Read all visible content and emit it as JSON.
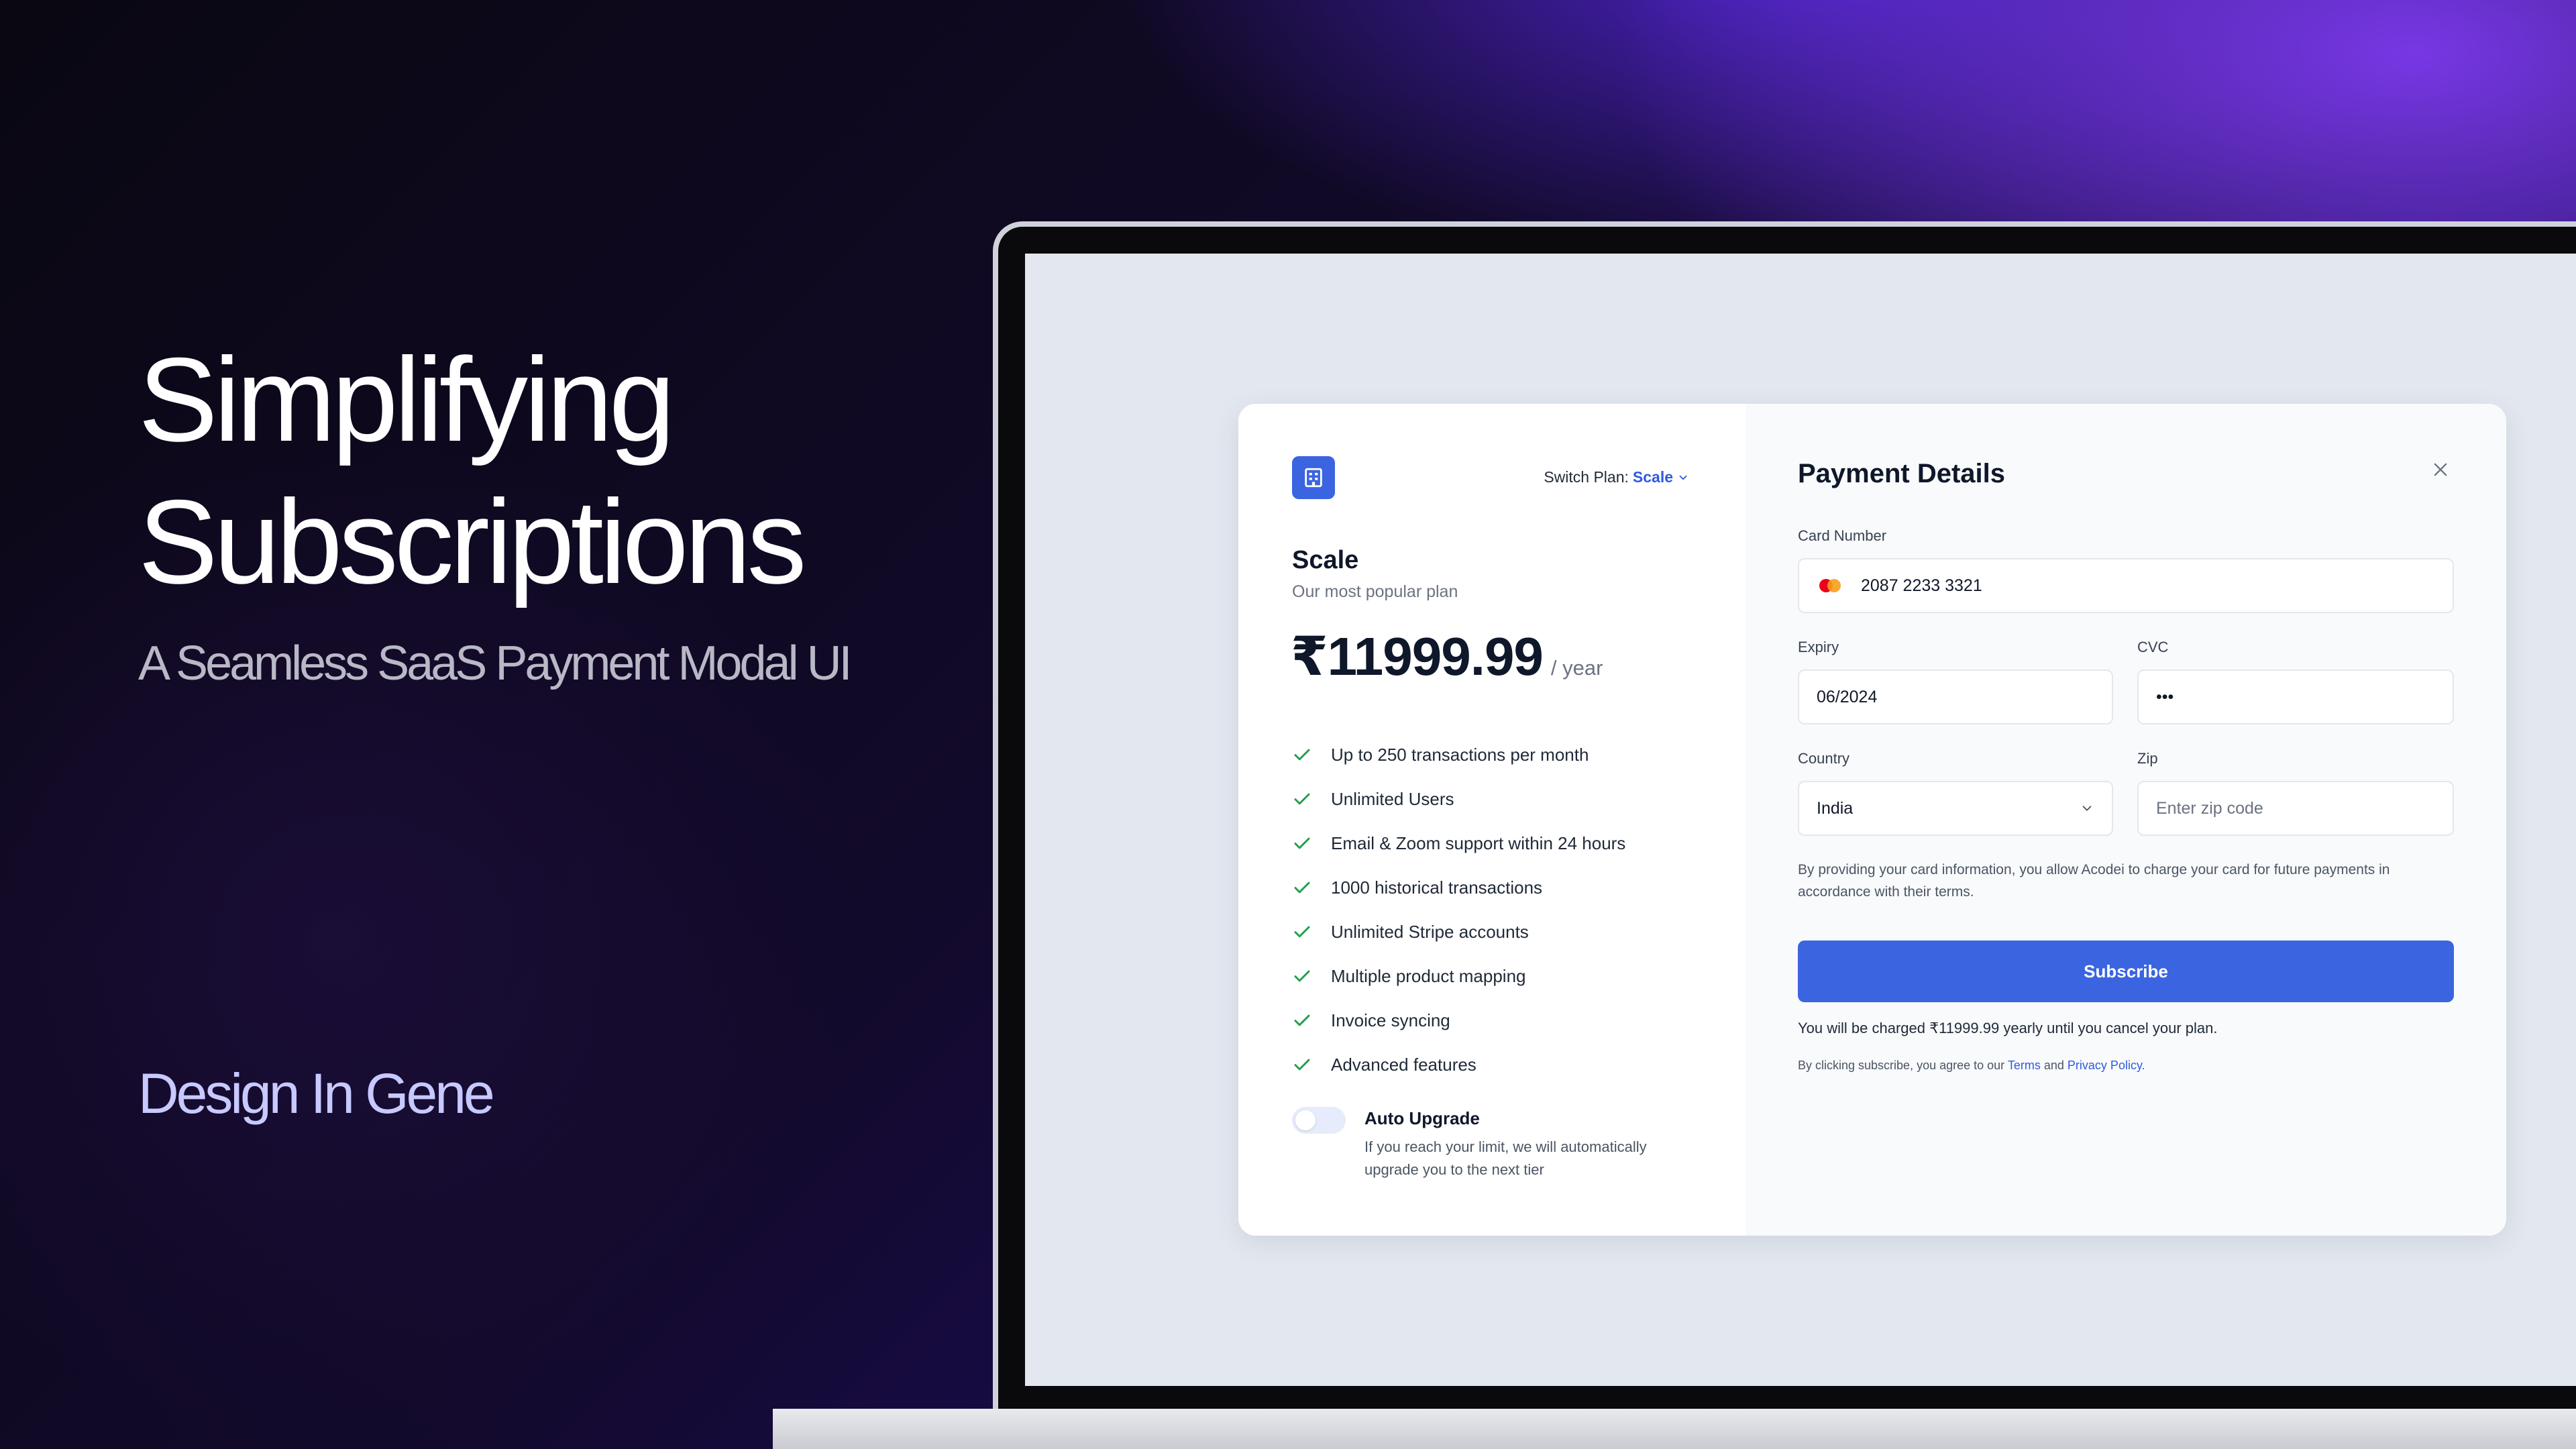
{
  "hero": {
    "title_line1": "Simplifying",
    "title_line2": "Subscriptions",
    "subtitle": "A Seamless SaaS Payment Modal UI"
  },
  "brand": "Design In Gene",
  "plan_panel": {
    "logo_icon": "building-icon",
    "switch_plan_label": "Switch Plan:",
    "switch_plan_value": "Scale",
    "plan_name": "Scale",
    "plan_desc": "Our most popular plan",
    "price": "₹11999.99",
    "period": "/ year",
    "features": [
      "Up to 250 transactions per month",
      "Unlimited Users",
      "Email & Zoom support within 24 hours",
      "1000 historical transactions",
      "Unlimited Stripe accounts",
      "Multiple product mapping",
      "Invoice syncing",
      "Advanced features"
    ],
    "auto_upgrade": {
      "title": "Auto Upgrade",
      "desc": "If you reach your limit, we will automatically upgrade you to the next tier",
      "enabled": false
    }
  },
  "payment": {
    "title": "Payment Details",
    "card_number_label": "Card Number",
    "card_number_value": "2087 2233 3321",
    "expiry_label": "Expiry",
    "expiry_value": "06/2024",
    "cvc_label": "CVC",
    "cvc_value": "•••",
    "country_label": "Country",
    "country_value": "India",
    "zip_label": "Zip",
    "zip_placeholder": "Enter zip code",
    "notice": "By providing your card information, you allow Acodei to charge your card for future payments in accordance with their terms.",
    "subscribe_label": "Subscribe",
    "charged_text": "You will be charged ₹11999.99 yearly until you cancel your plan.",
    "agree_prefix": "By clicking subscribe, you agree to our",
    "terms_link": "Terms",
    "and_text": "and",
    "privacy_link": "Privacy Policy."
  },
  "colors": {
    "accent": "#3b64e0",
    "check_green": "#22a04b",
    "link": "#2f5be0"
  }
}
